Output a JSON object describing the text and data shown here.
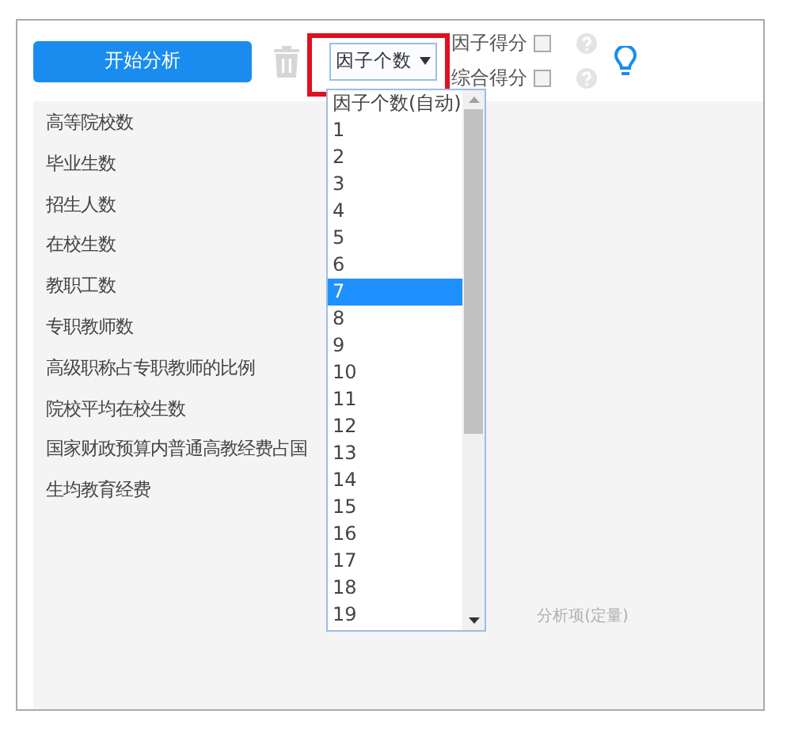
{
  "toolbar": {
    "start_button": "开始分析",
    "factor_select": {
      "value": "因子个数",
      "expanded": true,
      "highlighted": true
    },
    "options": [
      {
        "label": "因子得分",
        "checked": false
      },
      {
        "label": "综合得分",
        "checked": false
      }
    ]
  },
  "variables": [
    "高等院校数",
    "毕业生数",
    "招生人数",
    "在校生数",
    "教职工数",
    "专职教师数",
    "高级职称占专职教师的比例",
    "院校平均在校生数",
    "国家财政预算内普通高教经费占国",
    "生均教育经费"
  ],
  "dropdown": {
    "items": [
      {
        "label": "因子个数(自动)",
        "selected": false
      },
      {
        "label": "1",
        "selected": false
      },
      {
        "label": "2",
        "selected": false
      },
      {
        "label": "3",
        "selected": false
      },
      {
        "label": "4",
        "selected": false
      },
      {
        "label": "5",
        "selected": false
      },
      {
        "label": "6",
        "selected": false
      },
      {
        "label": "7",
        "selected": true
      },
      {
        "label": "8",
        "selected": false
      },
      {
        "label": "9",
        "selected": false
      },
      {
        "label": "10",
        "selected": false
      },
      {
        "label": "11",
        "selected": false
      },
      {
        "label": "12",
        "selected": false
      },
      {
        "label": "13",
        "selected": false
      },
      {
        "label": "14",
        "selected": false
      },
      {
        "label": "15",
        "selected": false
      },
      {
        "label": "16",
        "selected": false
      },
      {
        "label": "17",
        "selected": false
      },
      {
        "label": "18",
        "selected": false
      },
      {
        "label": "19",
        "selected": false
      }
    ]
  },
  "drop_hint": "分析项(定量)"
}
